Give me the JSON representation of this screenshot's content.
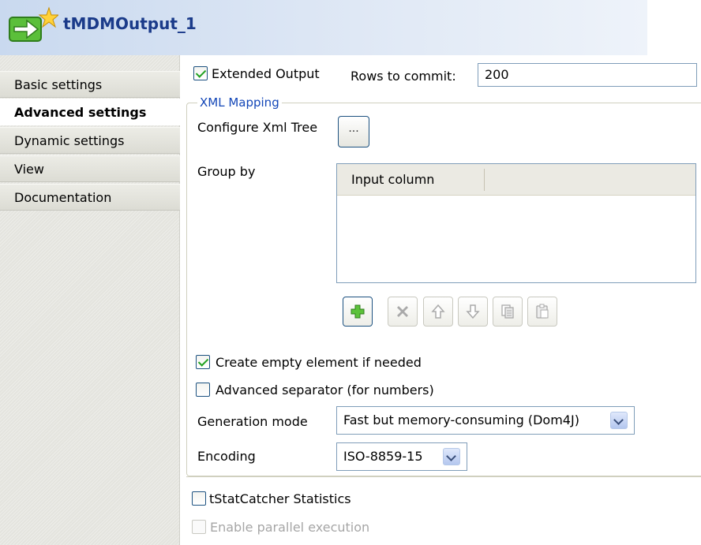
{
  "header": {
    "title": "tMDMOutput_1",
    "icon": "component-arrow-star-icon"
  },
  "sidebar": {
    "items": [
      {
        "label": "Basic settings",
        "active": false
      },
      {
        "label": "Advanced settings",
        "active": true
      },
      {
        "label": "Dynamic settings",
        "active": false
      },
      {
        "label": "View",
        "active": false
      },
      {
        "label": "Documentation",
        "active": false
      }
    ]
  },
  "extended_output": {
    "label": "Extended Output",
    "checked": true
  },
  "rows_to_commit": {
    "label": "Rows to commit:",
    "value": "200"
  },
  "xml_mapping": {
    "legend": "XML Mapping",
    "configure_label": "Configure Xml Tree",
    "configure_button": "...",
    "group_by_label": "Group by",
    "table": {
      "columns": [
        "Input column"
      ],
      "rows": []
    },
    "toolbar": [
      "add-icon",
      "delete-icon",
      "move-up-icon",
      "move-down-icon",
      "copy-icon",
      "paste-icon"
    ],
    "create_empty": {
      "label": "Create empty element if needed",
      "checked": true
    },
    "advanced_separator": {
      "label": "Advanced separator (for numbers)",
      "checked": false
    },
    "generation_mode": {
      "label": "Generation mode",
      "value": "Fast but memory-consuming (Dom4J)"
    },
    "encoding": {
      "label": "Encoding",
      "value": "ISO-8859-15"
    }
  },
  "tstatcatcher": {
    "label": "tStatCatcher Statistics",
    "checked": false
  },
  "parallel": {
    "label": "Enable parallel execution",
    "checked": false,
    "disabled": true
  },
  "colors": {
    "accent": "#1447b8",
    "checkmark": "#21a121",
    "border": "#7f9db9"
  }
}
